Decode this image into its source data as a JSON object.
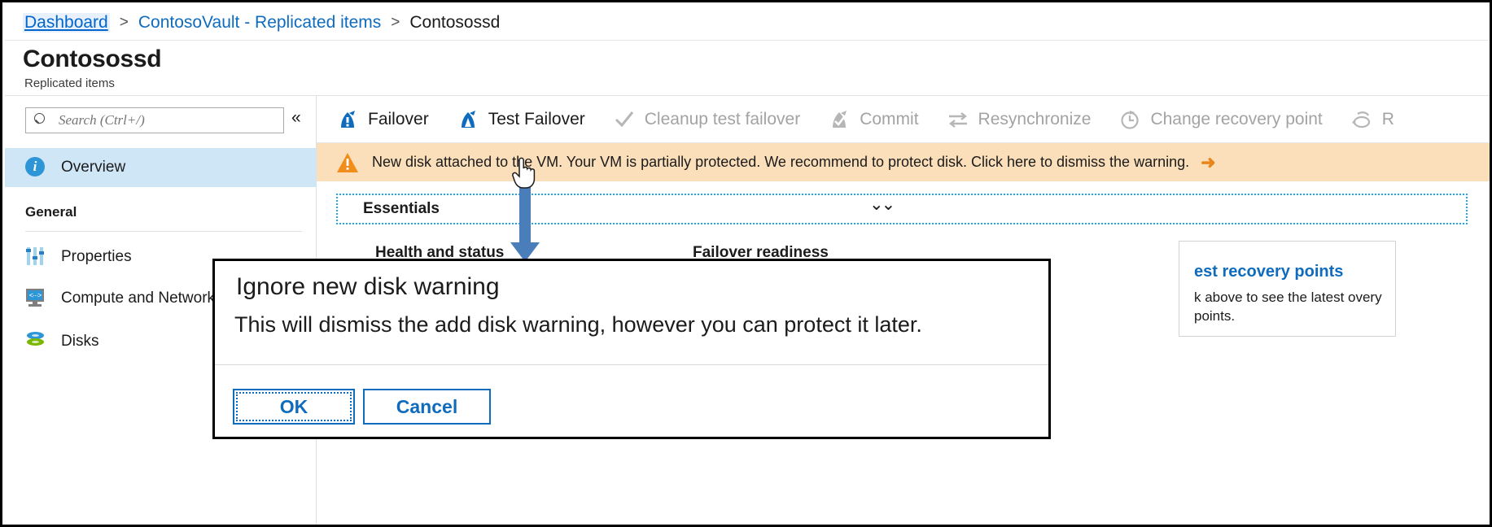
{
  "breadcrumb": {
    "root": "Dashboard",
    "sep": ">",
    "middle": "ContosoVault - Replicated items",
    "current": "Contosossd"
  },
  "header": {
    "title": "Contosossd",
    "subtitle": "Replicated items"
  },
  "sidebar": {
    "search": {
      "placeholder": "Search (Ctrl+/)",
      "value": ""
    },
    "collapse_label": "«",
    "items": [
      {
        "label": "Overview",
        "icon": "info-icon",
        "selected": true
      }
    ],
    "section_general": "General",
    "general_items": [
      {
        "label": "Properties",
        "icon": "sliders-icon"
      },
      {
        "label": "Compute and Network",
        "icon": "monitor-icon"
      },
      {
        "label": "Disks",
        "icon": "disks-icon"
      }
    ]
  },
  "toolbar": {
    "items": [
      {
        "label": "Failover",
        "icon": "failover-icon",
        "enabled": true
      },
      {
        "label": "Test Failover",
        "icon": "test-failover-icon",
        "enabled": true
      },
      {
        "label": "Cleanup test failover",
        "icon": "checkmark-icon",
        "enabled": false
      },
      {
        "label": "Commit",
        "icon": "commit-icon",
        "enabled": false
      },
      {
        "label": "Resynchronize",
        "icon": "resynchronize-icon",
        "enabled": false
      },
      {
        "label": "Change recovery point",
        "icon": "clock-icon",
        "enabled": false
      },
      {
        "label": "R",
        "icon": "rechange-icon",
        "enabled": false
      }
    ]
  },
  "banner": {
    "icon": "warning-triangle-icon",
    "text": "New disk attached to the VM. Your VM is partially protected. We recommend to protect disk. Click here to dismiss the warning.",
    "arrow": "➜",
    "bg_color": "#fbdfbb",
    "icon_color": "#f28c1a"
  },
  "essentials": {
    "label": "Essentials",
    "chevron": "⌄⌄"
  },
  "main": {
    "health_heading": "Health and status",
    "failover_heading": "Failover readiness",
    "recovery_card": {
      "title": "est recovery points",
      "body": "k above to see the latest\novery points.",
      "title_color": "#0f6cbd"
    }
  },
  "dialog": {
    "title": "Ignore new disk warning",
    "body": "This will dismiss the add disk warning, however you can protect it later.",
    "ok_label": "OK",
    "cancel_label": "Cancel",
    "accent_color": "#0f6cbd"
  },
  "annotations": {
    "arrow_color": "#4a7ebb",
    "dotted_box_color": "#1fa5e8"
  }
}
